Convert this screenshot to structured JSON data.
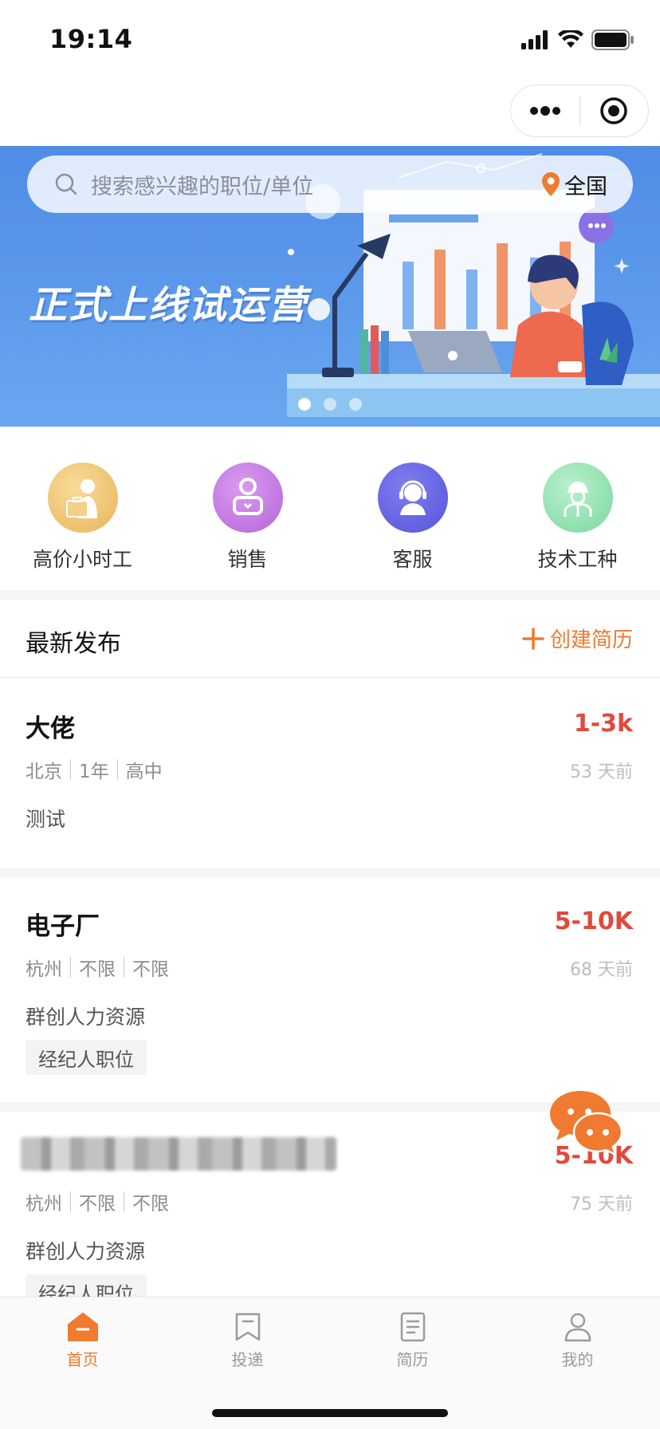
{
  "status_bar": {
    "time": "19:14"
  },
  "banner": {
    "search_placeholder": "搜索感兴趣的职位/单位",
    "location": "全国",
    "slogan": "正式上线试运营",
    "slide_count": 3,
    "active_slide": 1
  },
  "categories": [
    {
      "label": "高价小时工",
      "icon": "briefcase-person-icon",
      "color": "#f0c36e"
    },
    {
      "label": "销售",
      "icon": "sales-person-icon",
      "color": "#c77be0"
    },
    {
      "label": "客服",
      "icon": "headset-person-icon",
      "color": "#6b6ae6"
    },
    {
      "label": "技术工种",
      "icon": "worker-helmet-icon",
      "color": "#8fe0b0"
    }
  ],
  "section": {
    "title": "最新发布",
    "create_resume": "创建简历"
  },
  "jobs": [
    {
      "title": "大佬",
      "salary": "1-3k",
      "location": "北京",
      "experience": "1年",
      "education": "高中",
      "time": "53 天前",
      "company": "测试",
      "tag": ""
    },
    {
      "title": "电子厂",
      "salary": "5-10K",
      "location": "杭州",
      "experience": "不限",
      "education": "不限",
      "time": "68 天前",
      "company": "群创人力资源",
      "tag": "经纪人职位"
    },
    {
      "title": "",
      "salary": "5-10K",
      "location": "杭州",
      "experience": "不限",
      "education": "不限",
      "time": "75 天前",
      "company": "群创人力资源",
      "tag": "经纪人职位"
    }
  ],
  "tabbar": {
    "items": [
      {
        "label": "首页",
        "icon": "home-icon",
        "active": true
      },
      {
        "label": "投递",
        "icon": "bookmark-icon",
        "active": false
      },
      {
        "label": "简历",
        "icon": "document-icon",
        "active": false
      },
      {
        "label": "我的",
        "icon": "user-icon",
        "active": false
      }
    ]
  },
  "colors": {
    "accent": "#ef7a30",
    "salary": "#e04a3c",
    "banner": "#5e9bec"
  }
}
